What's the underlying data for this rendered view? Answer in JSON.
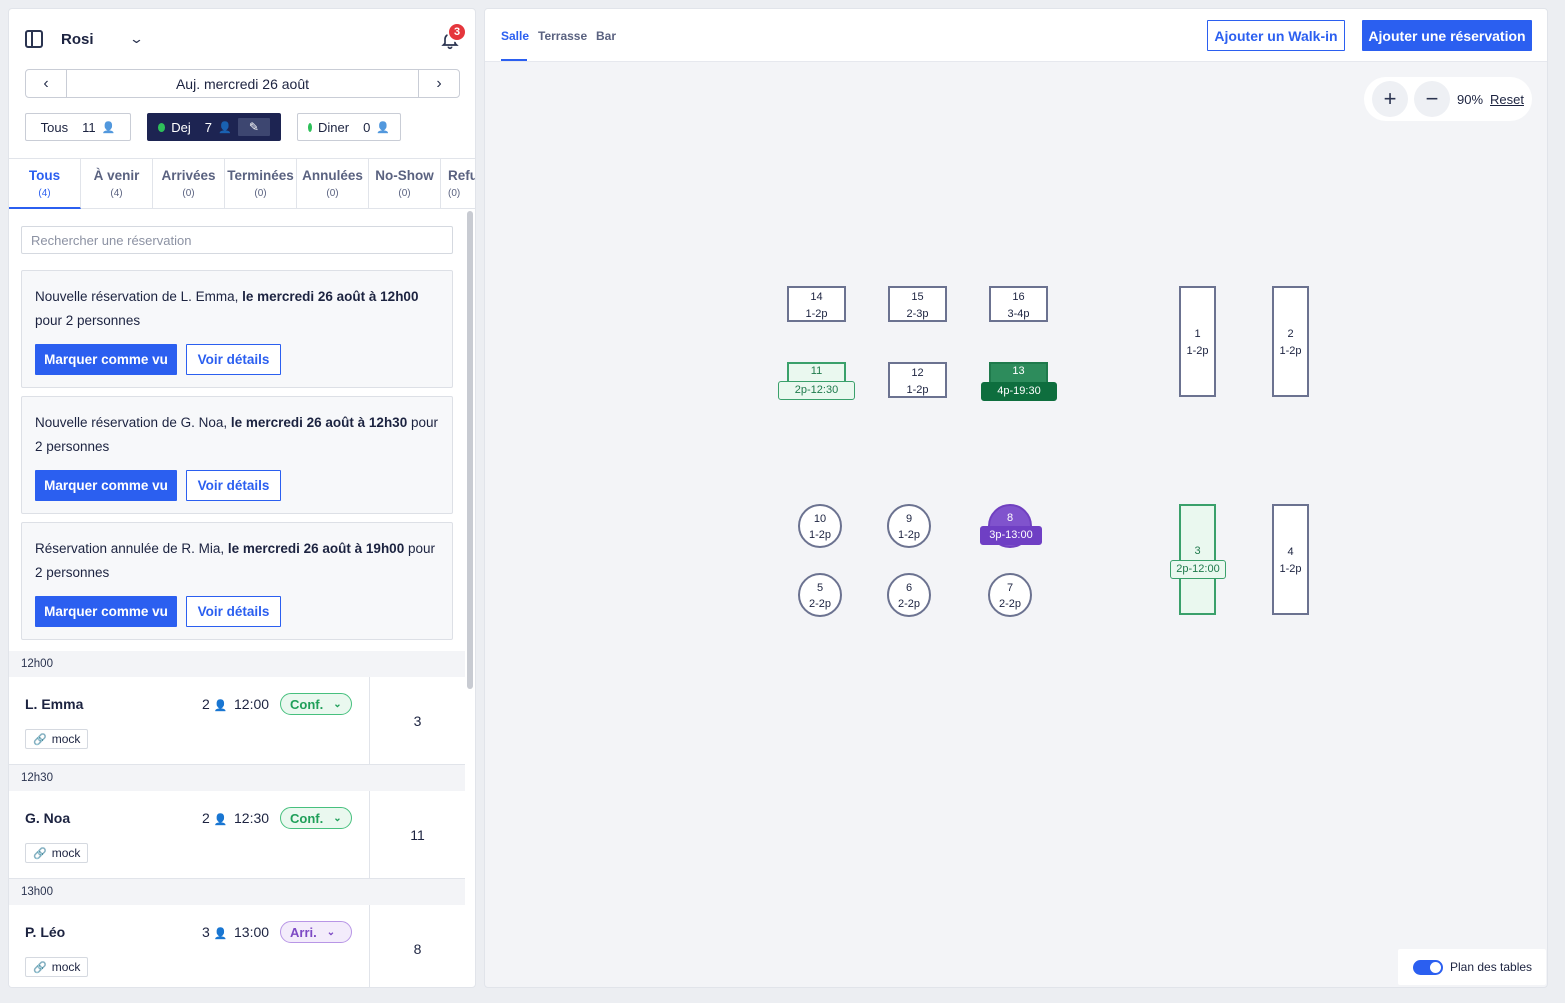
{
  "header": {
    "restaurant": "Rosi",
    "notifications": "3"
  },
  "date": {
    "label": "Auj. mercredi 26 août"
  },
  "services": [
    {
      "label": "Tous",
      "count": "11"
    },
    {
      "label": "Dej",
      "count": "7"
    },
    {
      "label": "Diner",
      "count": "0"
    }
  ],
  "status_tabs": [
    {
      "label": "Tous",
      "count": "(4)"
    },
    {
      "label": "À venir",
      "count": "(4)"
    },
    {
      "label": "Arrivées",
      "count": "(0)"
    },
    {
      "label": "Terminées",
      "count": "(0)"
    },
    {
      "label": "Annulées",
      "count": "(0)"
    },
    {
      "label": "No-Show",
      "count": "(0)"
    },
    {
      "label": "Refusées",
      "count": "(0)"
    }
  ],
  "search": {
    "placeholder": "Rechercher une réservation"
  },
  "notifications": [
    {
      "pre": "Nouvelle réservation de L. Emma, ",
      "bold": "le mercredi 26 août à 12h00",
      "post": " pour 2 personnes",
      "primary": "Marquer comme vu",
      "secondary": "Voir détails"
    },
    {
      "pre": "Nouvelle réservation de G. Noa, ",
      "bold": "le mercredi 26 août à 12h30",
      "post": " pour 2 personnes",
      "primary": "Marquer comme vu",
      "secondary": "Voir détails"
    },
    {
      "pre": "Réservation annulée de R. Mia, ",
      "bold": "le mercredi 26 août à 19h00",
      "post": " pour 2 personnes",
      "primary": "Marquer comme vu",
      "secondary": "Voir détails"
    }
  ],
  "reservations": [
    {
      "slot": "12h00",
      "name": "L. Emma",
      "covers": "2",
      "time": "12:00",
      "status": "Conf.",
      "tag": "mock",
      "table": "3"
    },
    {
      "slot": "12h30",
      "name": "G. Noa",
      "covers": "2",
      "time": "12:30",
      "status": "Conf.",
      "tag": "mock",
      "table": "11"
    },
    {
      "slot": "13h00",
      "name": "P. Léo",
      "covers": "3",
      "time": "13:00",
      "status": "Arri.",
      "tag": "mock",
      "table": "8"
    }
  ],
  "room_tabs": [
    "Salle",
    "Terrasse",
    "Bar"
  ],
  "actions": {
    "walkin": "Ajouter un Walk-in",
    "reservation": "Ajouter une réservation"
  },
  "zoom": {
    "level": "90%",
    "reset": "Reset"
  },
  "tables": [
    {
      "num": "14",
      "cap": "1-2p"
    },
    {
      "num": "15",
      "cap": "2-3p"
    },
    {
      "num": "16",
      "cap": "3-4p"
    },
    {
      "num": "11",
      "label": "2p-12:30"
    },
    {
      "num": "12",
      "cap": "1-2p"
    },
    {
      "num": "13",
      "label": "4p-19:30"
    },
    {
      "num": "1",
      "cap": "1-2p"
    },
    {
      "num": "2",
      "cap": "1-2p"
    },
    {
      "num": "10",
      "cap": "1-2p"
    },
    {
      "num": "9",
      "cap": "1-2p"
    },
    {
      "num": "8",
      "label": "3p-13:00"
    },
    {
      "num": "5",
      "cap": "2-2p"
    },
    {
      "num": "6",
      "cap": "2-2p"
    },
    {
      "num": "7",
      "cap": "2-2p"
    },
    {
      "num": "3",
      "label": "2p-12:00"
    },
    {
      "num": "4",
      "cap": "1-2p"
    }
  ],
  "toggle": {
    "label": "Plan des tables"
  },
  "colors": {
    "accent": "#2b5ff0",
    "navy": "#1d2452",
    "green": "#2ec05a",
    "purple": "#8053cd",
    "badge": "#e5363c"
  }
}
